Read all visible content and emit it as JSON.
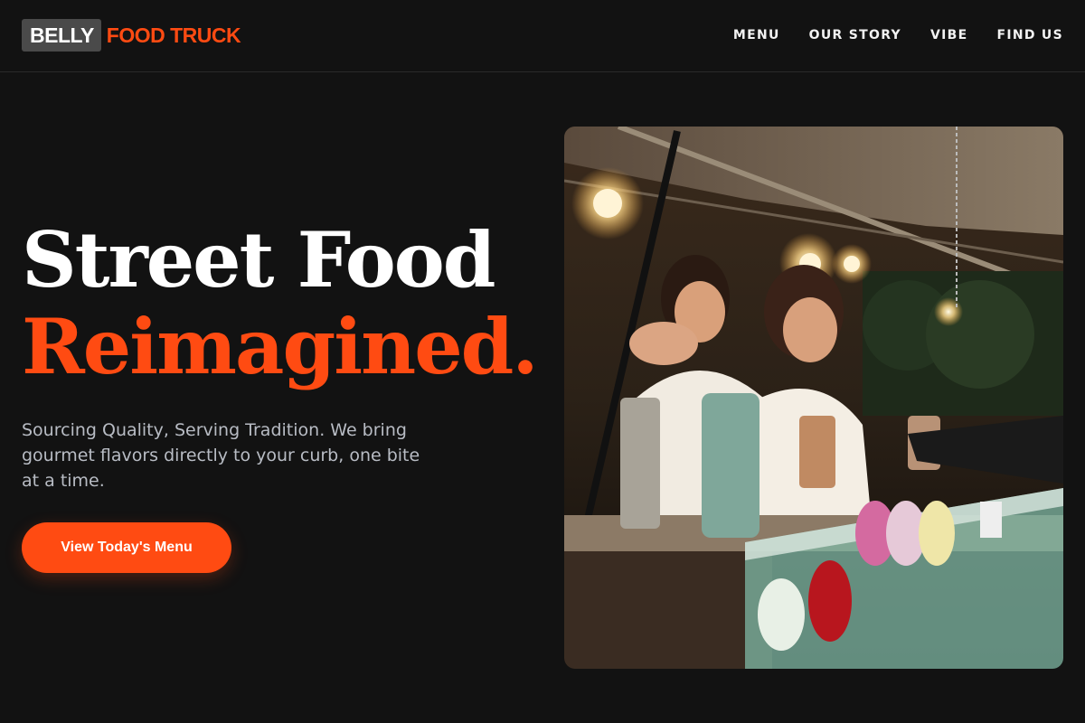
{
  "brand": {
    "box_text": "BELLY",
    "accent_text": "FOOD TRUCK",
    "accent_color": "#ff4b12"
  },
  "nav": {
    "items": [
      {
        "label": "MENU"
      },
      {
        "label": "OUR STORY"
      },
      {
        "label": "VIBE"
      },
      {
        "label": "FIND US"
      }
    ]
  },
  "hero": {
    "title_line1": "Street Food",
    "title_line2": "Reimagined.",
    "subtitle": "Sourcing Quality, Serving Tradition. We bring gourmet flavors directly to your curb, one bite at a time.",
    "cta_label": "View Today's Menu",
    "image_alt": "Two cooks serving food from a lit food truck window"
  },
  "colors": {
    "background": "#121212",
    "accent": "#ff4b12",
    "text": "#ffffff",
    "muted_text": "#b8bcc4"
  }
}
